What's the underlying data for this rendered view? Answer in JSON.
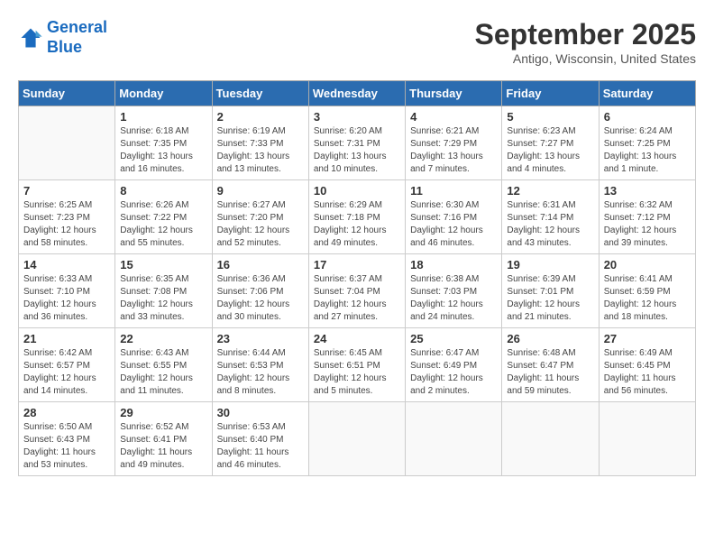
{
  "header": {
    "logo_line1": "General",
    "logo_line2": "Blue",
    "month": "September 2025",
    "location": "Antigo, Wisconsin, United States"
  },
  "weekdays": [
    "Sunday",
    "Monday",
    "Tuesday",
    "Wednesday",
    "Thursday",
    "Friday",
    "Saturday"
  ],
  "weeks": [
    [
      {
        "day": "",
        "sunrise": "",
        "sunset": "",
        "daylight": ""
      },
      {
        "day": "1",
        "sunrise": "Sunrise: 6:18 AM",
        "sunset": "Sunset: 7:35 PM",
        "daylight": "Daylight: 13 hours and 16 minutes."
      },
      {
        "day": "2",
        "sunrise": "Sunrise: 6:19 AM",
        "sunset": "Sunset: 7:33 PM",
        "daylight": "Daylight: 13 hours and 13 minutes."
      },
      {
        "day": "3",
        "sunrise": "Sunrise: 6:20 AM",
        "sunset": "Sunset: 7:31 PM",
        "daylight": "Daylight: 13 hours and 10 minutes."
      },
      {
        "day": "4",
        "sunrise": "Sunrise: 6:21 AM",
        "sunset": "Sunset: 7:29 PM",
        "daylight": "Daylight: 13 hours and 7 minutes."
      },
      {
        "day": "5",
        "sunrise": "Sunrise: 6:23 AM",
        "sunset": "Sunset: 7:27 PM",
        "daylight": "Daylight: 13 hours and 4 minutes."
      },
      {
        "day": "6",
        "sunrise": "Sunrise: 6:24 AM",
        "sunset": "Sunset: 7:25 PM",
        "daylight": "Daylight: 13 hours and 1 minute."
      }
    ],
    [
      {
        "day": "7",
        "sunrise": "Sunrise: 6:25 AM",
        "sunset": "Sunset: 7:23 PM",
        "daylight": "Daylight: 12 hours and 58 minutes."
      },
      {
        "day": "8",
        "sunrise": "Sunrise: 6:26 AM",
        "sunset": "Sunset: 7:22 PM",
        "daylight": "Daylight: 12 hours and 55 minutes."
      },
      {
        "day": "9",
        "sunrise": "Sunrise: 6:27 AM",
        "sunset": "Sunset: 7:20 PM",
        "daylight": "Daylight: 12 hours and 52 minutes."
      },
      {
        "day": "10",
        "sunrise": "Sunrise: 6:29 AM",
        "sunset": "Sunset: 7:18 PM",
        "daylight": "Daylight: 12 hours and 49 minutes."
      },
      {
        "day": "11",
        "sunrise": "Sunrise: 6:30 AM",
        "sunset": "Sunset: 7:16 PM",
        "daylight": "Daylight: 12 hours and 46 minutes."
      },
      {
        "day": "12",
        "sunrise": "Sunrise: 6:31 AM",
        "sunset": "Sunset: 7:14 PM",
        "daylight": "Daylight: 12 hours and 43 minutes."
      },
      {
        "day": "13",
        "sunrise": "Sunrise: 6:32 AM",
        "sunset": "Sunset: 7:12 PM",
        "daylight": "Daylight: 12 hours and 39 minutes."
      }
    ],
    [
      {
        "day": "14",
        "sunrise": "Sunrise: 6:33 AM",
        "sunset": "Sunset: 7:10 PM",
        "daylight": "Daylight: 12 hours and 36 minutes."
      },
      {
        "day": "15",
        "sunrise": "Sunrise: 6:35 AM",
        "sunset": "Sunset: 7:08 PM",
        "daylight": "Daylight: 12 hours and 33 minutes."
      },
      {
        "day": "16",
        "sunrise": "Sunrise: 6:36 AM",
        "sunset": "Sunset: 7:06 PM",
        "daylight": "Daylight: 12 hours and 30 minutes."
      },
      {
        "day": "17",
        "sunrise": "Sunrise: 6:37 AM",
        "sunset": "Sunset: 7:04 PM",
        "daylight": "Daylight: 12 hours and 27 minutes."
      },
      {
        "day": "18",
        "sunrise": "Sunrise: 6:38 AM",
        "sunset": "Sunset: 7:03 PM",
        "daylight": "Daylight: 12 hours and 24 minutes."
      },
      {
        "day": "19",
        "sunrise": "Sunrise: 6:39 AM",
        "sunset": "Sunset: 7:01 PM",
        "daylight": "Daylight: 12 hours and 21 minutes."
      },
      {
        "day": "20",
        "sunrise": "Sunrise: 6:41 AM",
        "sunset": "Sunset: 6:59 PM",
        "daylight": "Daylight: 12 hours and 18 minutes."
      }
    ],
    [
      {
        "day": "21",
        "sunrise": "Sunrise: 6:42 AM",
        "sunset": "Sunset: 6:57 PM",
        "daylight": "Daylight: 12 hours and 14 minutes."
      },
      {
        "day": "22",
        "sunrise": "Sunrise: 6:43 AM",
        "sunset": "Sunset: 6:55 PM",
        "daylight": "Daylight: 12 hours and 11 minutes."
      },
      {
        "day": "23",
        "sunrise": "Sunrise: 6:44 AM",
        "sunset": "Sunset: 6:53 PM",
        "daylight": "Daylight: 12 hours and 8 minutes."
      },
      {
        "day": "24",
        "sunrise": "Sunrise: 6:45 AM",
        "sunset": "Sunset: 6:51 PM",
        "daylight": "Daylight: 12 hours and 5 minutes."
      },
      {
        "day": "25",
        "sunrise": "Sunrise: 6:47 AM",
        "sunset": "Sunset: 6:49 PM",
        "daylight": "Daylight: 12 hours and 2 minutes."
      },
      {
        "day": "26",
        "sunrise": "Sunrise: 6:48 AM",
        "sunset": "Sunset: 6:47 PM",
        "daylight": "Daylight: 11 hours and 59 minutes."
      },
      {
        "day": "27",
        "sunrise": "Sunrise: 6:49 AM",
        "sunset": "Sunset: 6:45 PM",
        "daylight": "Daylight: 11 hours and 56 minutes."
      }
    ],
    [
      {
        "day": "28",
        "sunrise": "Sunrise: 6:50 AM",
        "sunset": "Sunset: 6:43 PM",
        "daylight": "Daylight: 11 hours and 53 minutes."
      },
      {
        "day": "29",
        "sunrise": "Sunrise: 6:52 AM",
        "sunset": "Sunset: 6:41 PM",
        "daylight": "Daylight: 11 hours and 49 minutes."
      },
      {
        "day": "30",
        "sunrise": "Sunrise: 6:53 AM",
        "sunset": "Sunset: 6:40 PM",
        "daylight": "Daylight: 11 hours and 46 minutes."
      },
      {
        "day": "",
        "sunrise": "",
        "sunset": "",
        "daylight": ""
      },
      {
        "day": "",
        "sunrise": "",
        "sunset": "",
        "daylight": ""
      },
      {
        "day": "",
        "sunrise": "",
        "sunset": "",
        "daylight": ""
      },
      {
        "day": "",
        "sunrise": "",
        "sunset": "",
        "daylight": ""
      }
    ]
  ]
}
